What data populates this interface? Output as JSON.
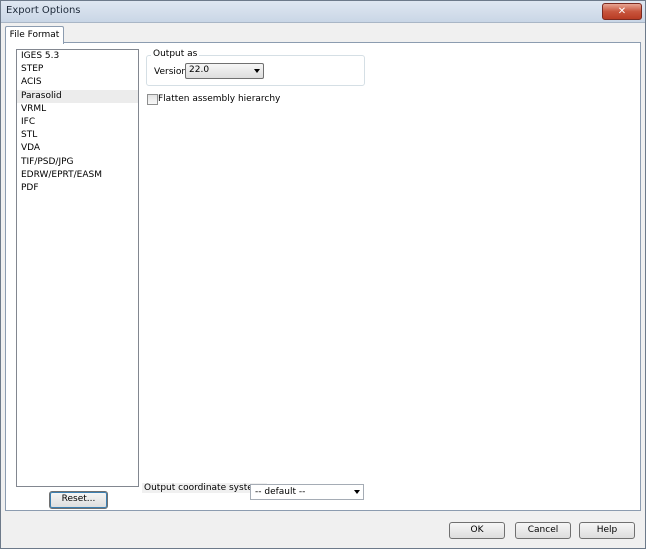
{
  "window": {
    "title": "Export Options",
    "close_glyph": "✕"
  },
  "tabs": [
    {
      "label": "File Format"
    }
  ],
  "format_list": {
    "items": [
      "IGES 5.3",
      "STEP",
      "ACIS",
      "Parasolid",
      "VRML",
      "IFC",
      "STL",
      "VDA",
      "TIF/PSD/JPG",
      "EDRW/EPRT/EASM",
      "PDF"
    ],
    "selected": "Parasolid"
  },
  "output_as": {
    "group_label": "Output as",
    "version_label": "Version:",
    "version_value": "22.0"
  },
  "flatten": {
    "label": "Flatten assembly hierarchy",
    "checked": false
  },
  "coordinate_system": {
    "label": "Output coordinate system:",
    "value": "-- default --"
  },
  "buttons": {
    "reset": "Reset...",
    "ok": "OK",
    "cancel": "Cancel",
    "help": "Help"
  },
  "colors": {
    "title_bar": "#c9d6e6",
    "close_button": "#c8553d",
    "window_bg": "#f0f0f0"
  },
  "icons": {
    "close": "close-icon",
    "dropdown": "chevron-down-icon"
  }
}
